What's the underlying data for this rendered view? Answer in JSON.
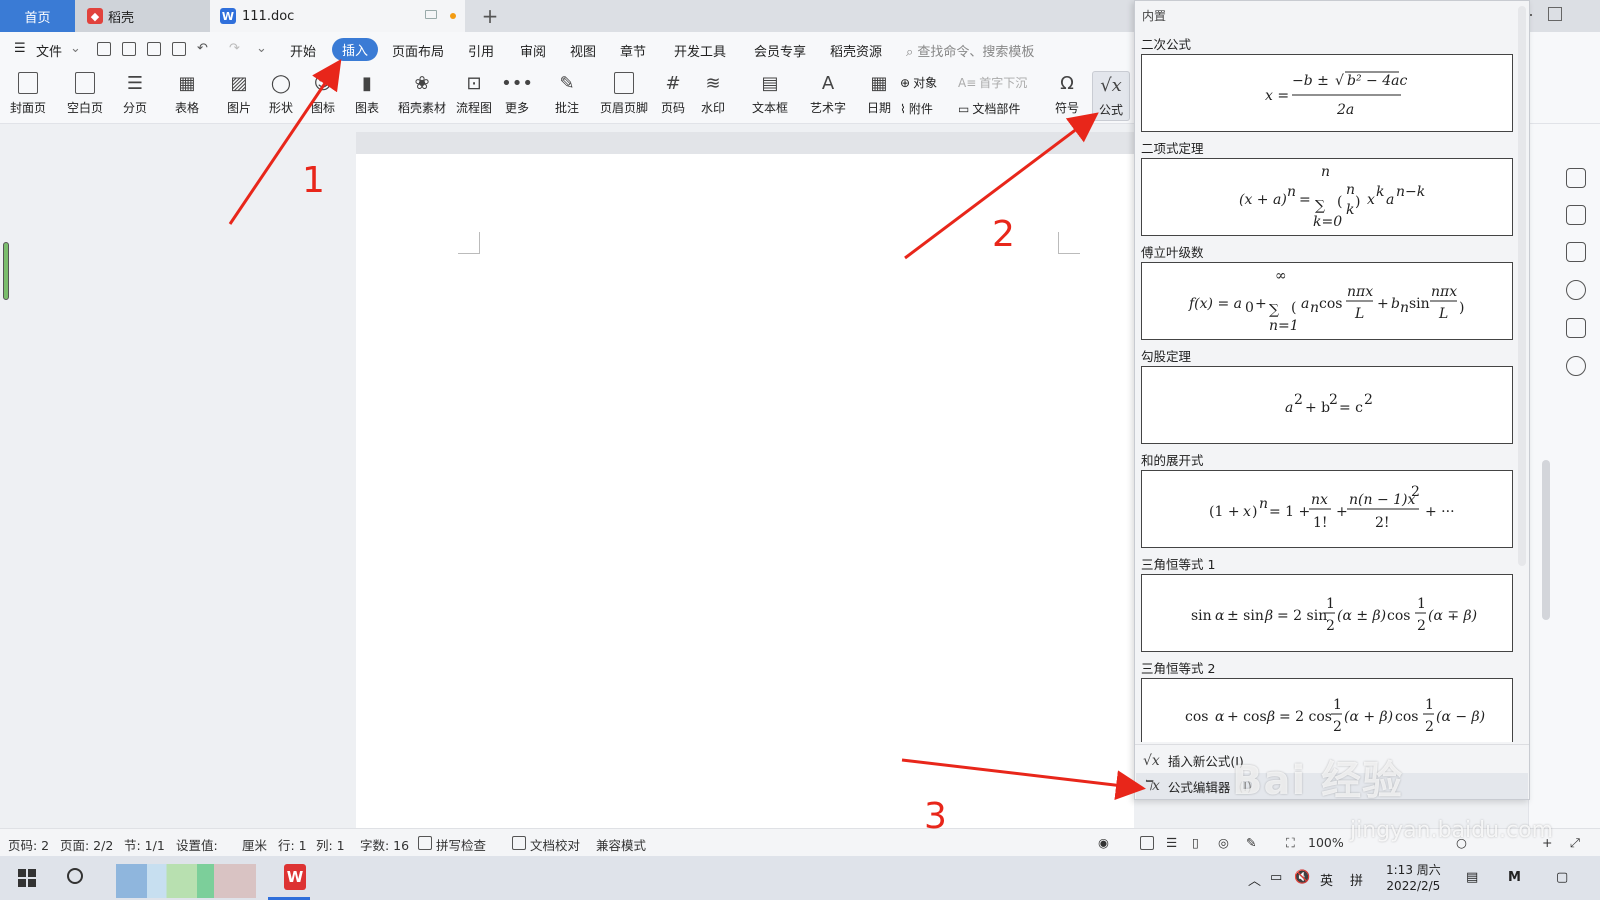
{
  "tabs": {
    "home": "首页",
    "daoke": "稻壳",
    "doc": "111.doc"
  },
  "menu": {
    "file": "文件",
    "items": [
      "开始",
      "插入",
      "页面布局",
      "引用",
      "审阅",
      "视图",
      "章节",
      "开发工具",
      "会员专享",
      "稻壳资源"
    ],
    "search_placeholder": "查找命令、搜索模板"
  },
  "ribbon": {
    "cover": "封面页",
    "blank": "空白页",
    "pagebreak": "分页",
    "table": "表格",
    "picture": "图片",
    "shape": "形状",
    "icon": "图标",
    "chart": "图表",
    "material": "稻壳素材",
    "flowchart": "流程图",
    "more": "更多",
    "comment": "批注",
    "headerfooter": "页眉页脚",
    "pagenum": "页码",
    "watermark": "水印",
    "textbox": "文本框",
    "wordart": "艺术字",
    "date": "日期",
    "object": "对象",
    "dropcap": "首字下沉",
    "attachment": "附件",
    "docparts": "文档部件",
    "symbol": "符号",
    "formula": "公式"
  },
  "dropdown": {
    "header": "内置",
    "equations": [
      {
        "label": "二次公式"
      },
      {
        "label": "二项式定理"
      },
      {
        "label": "傅立叶级数"
      },
      {
        "label": "勾股定理"
      },
      {
        "label": "和的展开式"
      },
      {
        "label": "三角恒等式 1"
      },
      {
        "label": "三角恒等式 2"
      }
    ],
    "insert_new": "插入新公式(I)",
    "editor": "公式编辑器",
    "editor_shortcut": "(I)"
  },
  "statusbar": {
    "page": "页码: 2",
    "pages": "页面: 2/2",
    "section": "节: 1/1",
    "settings": "设置值: ",
    "unit": "厘米",
    "row": "行: 1",
    "col": "列: 1",
    "words": "字数: 16",
    "spell": "拼写检查",
    "proof": "文档校对",
    "compat": "兼容模式",
    "zoom": "100%"
  },
  "taskbar": {
    "ime_lang": "英",
    "ime_mode": "拼",
    "time": "1:13 周六",
    "date": "2022/2/5"
  },
  "annotations": {
    "step1": "1",
    "step2": "2",
    "step3": "3",
    "watermark": "Bai 经验",
    "watermark_url": "jingyan.baidu.com"
  },
  "colors": {
    "accent": "#3a7bd5",
    "arrow": "#e8261a"
  }
}
